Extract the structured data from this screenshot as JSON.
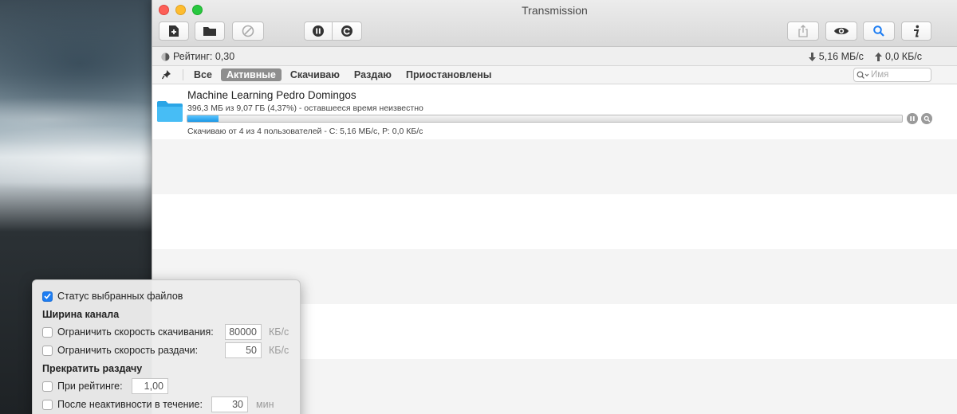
{
  "window": {
    "title": "Transmission"
  },
  "toolbar": {
    "buttons": [
      {
        "name": "add-torrent",
        "icon": "add-document-icon"
      },
      {
        "name": "open-folder",
        "icon": "folder-icon"
      },
      {
        "name": "remove-torrent",
        "icon": "prohibited-icon"
      },
      {
        "name": "pause-all",
        "icon": "pause-icon"
      },
      {
        "name": "resume-all",
        "icon": "resume-icon"
      },
      {
        "name": "share",
        "icon": "share-icon"
      },
      {
        "name": "quicklook",
        "icon": "eye-icon"
      },
      {
        "name": "search",
        "icon": "magnifier-icon"
      },
      {
        "name": "info",
        "icon": "info-icon"
      }
    ]
  },
  "status": {
    "rating": "Рейтинг: 0,30",
    "download_speed": "5,16 МБ/с",
    "upload_speed": "0,0 КБ/с"
  },
  "filters": {
    "items": [
      "Все",
      "Активные",
      "Скачиваю",
      "Раздаю",
      "Приостановлены"
    ],
    "active": "Активные",
    "search_placeholder": "Имя"
  },
  "torrents": [
    {
      "name": "Machine Learning Pedro Domingos",
      "info": "396,3 МБ из 9,07 ГБ (4,37%) - оставшееся время неизвестно",
      "progress": 0.0437,
      "status": "Скачиваю от 4 из 4 пользователей - С: 5,16 МБ/с, Р: 0,0 КБ/с"
    }
  ],
  "panel": {
    "selected_files_status": {
      "label": "Статус выбранных файлов",
      "checked": true
    },
    "bandwidth_heading": "Ширина канала",
    "limit_download": {
      "label": "Ограничить скорость скачивания:",
      "value": "80000",
      "unit": "КБ/с",
      "checked": false
    },
    "limit_upload": {
      "label": "Ограничить скорость раздачи:",
      "value": "50",
      "unit": "КБ/с",
      "checked": false
    },
    "stop_seeding_heading": "Прекратить раздачу",
    "at_ratio": {
      "label": "При рейтинге:",
      "value": "1,00",
      "checked": false
    },
    "after_inactivity": {
      "label": "После неактивности в течение:",
      "value": "30",
      "unit": "мин",
      "checked": false
    }
  },
  "colors": {
    "accent": "#1d7df2",
    "progress": "#1a97e6",
    "active_filter": "#8e8e8e"
  }
}
